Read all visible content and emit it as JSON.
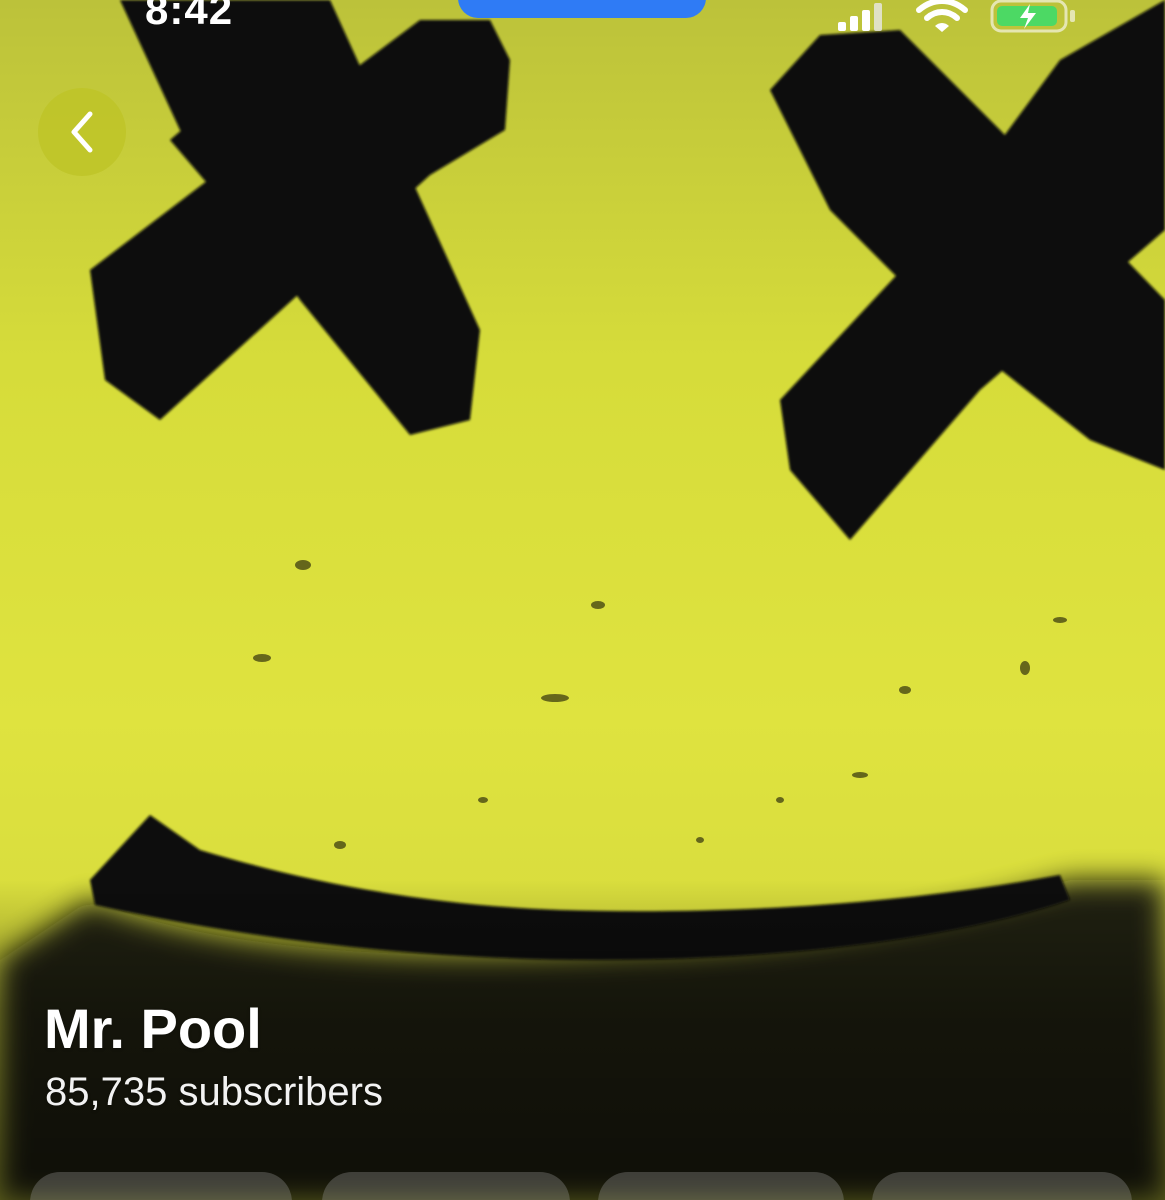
{
  "status_bar": {
    "time": "8:42",
    "signal_icon": "cellular-signal-icon",
    "wifi_icon": "wifi-icon",
    "battery_icon": "battery-charging-icon",
    "battery_color": "#4cd964",
    "dynamic_island_color": "#2f7bf5"
  },
  "header": {
    "back_icon": "chevron-left-icon"
  },
  "channel": {
    "name": "Mr. Pool",
    "subscribers": "85,735 subscribers",
    "cover_background_color": "#dfe33f",
    "cover_mark_color": "#0a0a08"
  },
  "actions": {
    "count_visible": 4
  }
}
